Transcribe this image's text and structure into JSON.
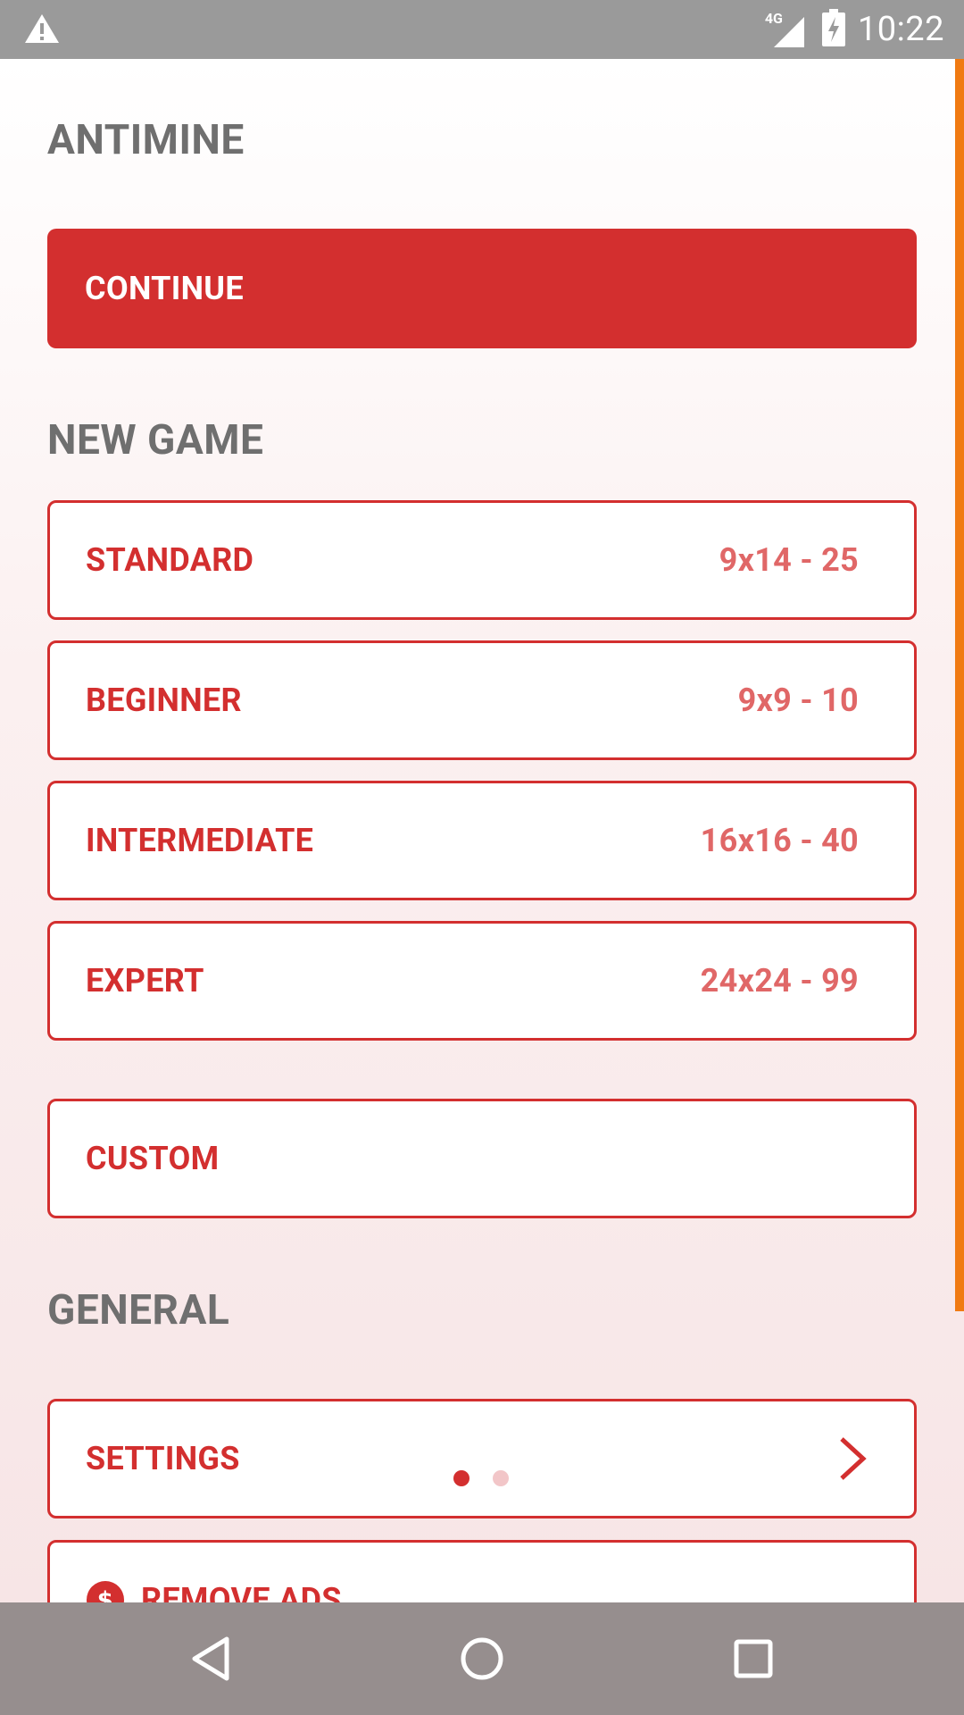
{
  "status_bar": {
    "network": "4G",
    "time": "10:22",
    "icons": [
      "warning-icon",
      "signal-icon",
      "battery-charging-icon"
    ]
  },
  "app": {
    "title": "ANTIMINE"
  },
  "continue": {
    "label": "CONTINUE"
  },
  "new_game": {
    "title": "NEW GAME",
    "items": [
      {
        "label": "STANDARD",
        "meta": "9x14 - 25"
      },
      {
        "label": "BEGINNER",
        "meta": "9x9 - 10"
      },
      {
        "label": "INTERMEDIATE",
        "meta": "16x16 - 40"
      },
      {
        "label": "EXPERT",
        "meta": "24x24 - 99"
      }
    ],
    "custom_label": "CUSTOM"
  },
  "general": {
    "title": "GENERAL",
    "settings_label": "SETTINGS",
    "settings_icon": "chevron-right-icon",
    "remove_ads_label": "REMOVE ADS",
    "remove_ads_icon": "dollar-icon"
  },
  "pager": {
    "pages": 2,
    "active_index": 0
  },
  "colors": {
    "accent": "#d32f2f",
    "meta_text": "#e06767",
    "section_text": "#6f6f6f",
    "status_bar": "#9a9a9a",
    "nav_bar": "#968e8e",
    "scroll_indicator": "#f07a12"
  },
  "nav_bar": {
    "buttons": [
      "back-icon",
      "home-icon",
      "recents-icon"
    ]
  }
}
